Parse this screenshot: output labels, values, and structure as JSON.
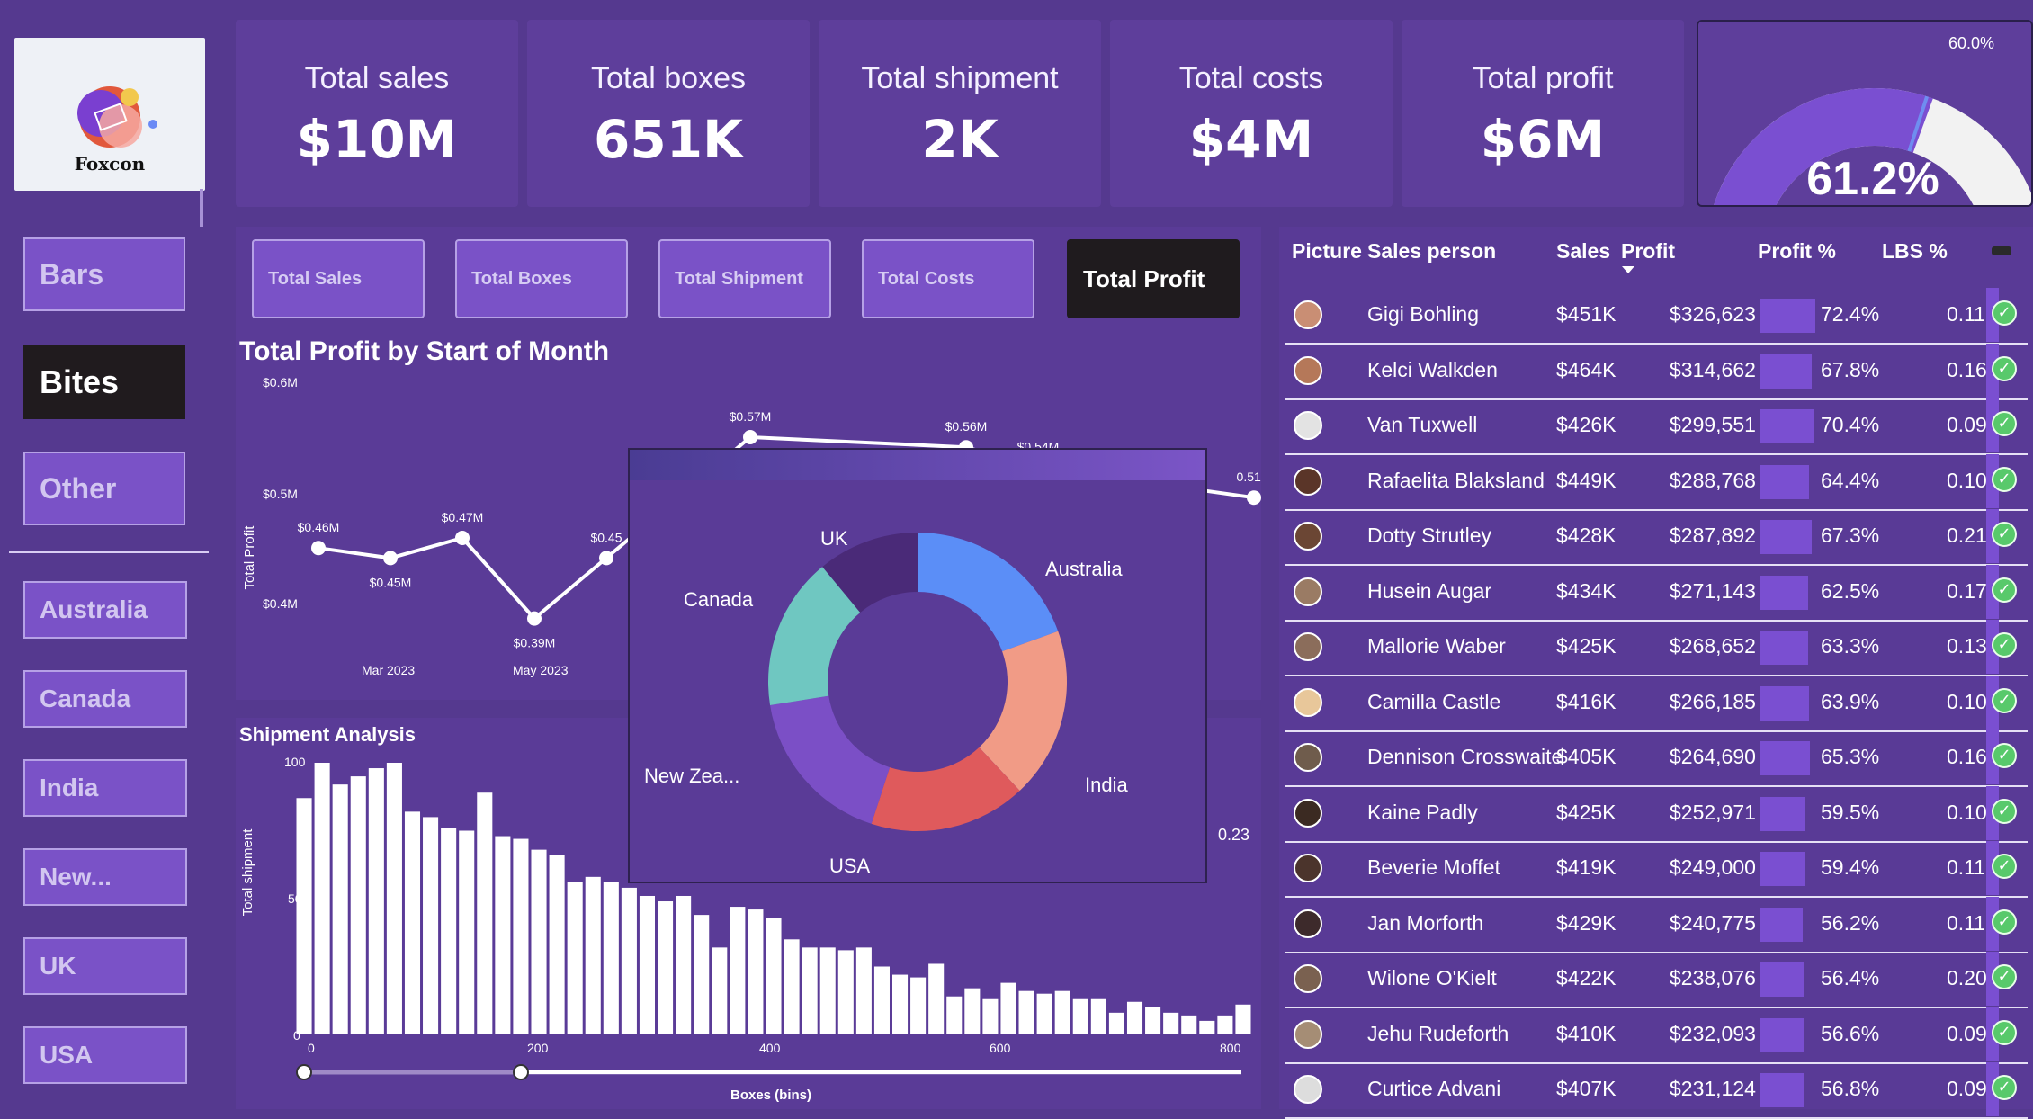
{
  "logo": {
    "brand": "Foxcon"
  },
  "nav": [
    "Bars",
    "Bites",
    "Other"
  ],
  "nav_active": "Bites",
  "countries": [
    "Australia",
    "Canada",
    "India",
    "New...",
    "UK",
    "USA"
  ],
  "kpis": [
    {
      "label": "Total sales",
      "value": "$10M"
    },
    {
      "label": "Total boxes",
      "value": "651K"
    },
    {
      "label": "Total shipment",
      "value": "2K"
    },
    {
      "label": "Total costs",
      "value": "$4M"
    },
    {
      "label": "Total profit",
      "value": "$6M"
    }
  ],
  "gauge": {
    "value": "61.2%",
    "target_label": "60.0%",
    "value_fraction": 0.612,
    "target_fraction": 0.6,
    "fill_color": "#7a4fd1",
    "rest_color": "#f2f2f2"
  },
  "tabs": [
    "Total Sales",
    "Total Boxes",
    "Total Shipment",
    "Total Costs",
    "Total Profit"
  ],
  "active_tab": "Total Profit",
  "line_chart": {
    "title": "Total Profit by Start of Month",
    "ylabel": "Total Profit",
    "y_ticks": [
      "$0.6M",
      "$0.5M",
      "$0.4M"
    ],
    "x_ticks": [
      "Mar 2023",
      "May 2023"
    ],
    "labels": [
      "$0.46M",
      "$0.45M",
      "$0.47M",
      "$0.39M",
      "$0.45",
      "$0.57M",
      "$0.56M",
      "$0.54M",
      "0.51M"
    ]
  },
  "histogram": {
    "title": "Shipment Analysis",
    "ylabel": "Total shipment",
    "xlabel": "Boxes (bins)",
    "y_ticks": [
      "100",
      "50",
      "0"
    ],
    "x_ticks": [
      "0",
      "200",
      "400",
      "600",
      "800"
    ],
    "edge_label": "0.23"
  },
  "chart_data": [
    {
      "type": "line",
      "title": "Total Profit by Start of Month",
      "ylabel": "Total Profit",
      "ylim": [
        0.37,
        0.62
      ],
      "points": [
        {
          "x": 0,
          "y": 0.46
        },
        {
          "x": 1,
          "y": 0.45
        },
        {
          "x": 2,
          "y": 0.47
        },
        {
          "x": 3,
          "y": 0.39
        },
        {
          "x": 4,
          "y": 0.45
        },
        {
          "x": 6,
          "y": 0.57
        },
        {
          "x": 9,
          "y": 0.56
        },
        {
          "x": 10,
          "y": 0.54
        },
        {
          "x": 13,
          "y": 0.51
        }
      ]
    },
    {
      "type": "bar",
      "title": "Shipment Analysis",
      "xlabel": "Boxes (bins)",
      "ylabel": "Total shipment",
      "xlim": [
        0,
        800
      ],
      "ylim": [
        0,
        100
      ],
      "values": [
        87,
        100,
        92,
        95,
        98,
        100,
        82,
        80,
        76,
        75,
        89,
        73,
        72,
        68,
        66,
        56,
        58,
        56,
        54,
        51,
        49,
        51,
        44,
        32,
        47,
        46,
        43,
        35,
        32,
        32,
        31,
        32,
        25,
        22,
        21,
        26,
        14,
        17,
        13,
        19,
        16,
        15,
        16,
        13,
        13,
        8,
        12,
        10,
        8,
        7,
        5,
        7,
        11
      ]
    },
    {
      "type": "pie",
      "slices": [
        {
          "label": "Australia",
          "value": 19.5,
          "color": "#5b8ef7"
        },
        {
          "label": "India",
          "value": 18.5,
          "color": "#f19b86"
        },
        {
          "label": "USA",
          "value": 17.0,
          "color": "#df5a5c"
        },
        {
          "label": "New Zea...",
          "value": 17.5,
          "color": "#7b4fc6"
        },
        {
          "label": "Canada",
          "value": 16.5,
          "color": "#6fc7c1"
        },
        {
          "label": "UK",
          "value": 11.0,
          "color": "#4a2a78"
        }
      ]
    }
  ],
  "table": {
    "headers": [
      "Picture",
      "Sales person",
      "Sales",
      "Profit",
      "Profit %",
      "LBS %"
    ],
    "rows": [
      [
        "Gigi Bohling",
        "$451K",
        "$326,623",
        "72.4%",
        "0.11"
      ],
      [
        "Kelci Walkden",
        "$464K",
        "$314,662",
        "67.8%",
        "0.16"
      ],
      [
        "Van Tuxwell",
        "$426K",
        "$299,551",
        "70.4%",
        "0.09"
      ],
      [
        "Rafaelita Blaksland",
        "$449K",
        "$288,768",
        "64.4%",
        "0.10"
      ],
      [
        "Dotty Strutley",
        "$428K",
        "$287,892",
        "67.3%",
        "0.21"
      ],
      [
        "Husein Augar",
        "$434K",
        "$271,143",
        "62.5%",
        "0.17"
      ],
      [
        "Mallorie Waber",
        "$425K",
        "$268,652",
        "63.3%",
        "0.13"
      ],
      [
        "Camilla Castle",
        "$416K",
        "$266,185",
        "63.9%",
        "0.10"
      ],
      [
        "Dennison Crosswaite",
        "$405K",
        "$264,690",
        "65.3%",
        "0.16"
      ],
      [
        "Kaine Padly",
        "$425K",
        "$252,971",
        "59.5%",
        "0.10"
      ],
      [
        "Beverie Moffet",
        "$419K",
        "$249,000",
        "59.4%",
        "0.11"
      ],
      [
        "Jan Morforth",
        "$429K",
        "$240,775",
        "56.2%",
        "0.11"
      ],
      [
        "Wilone O'Kielt",
        "$422K",
        "$238,076",
        "56.4%",
        "0.20"
      ],
      [
        "Jehu Rudeforth",
        "$410K",
        "$232,093",
        "56.6%",
        "0.09"
      ],
      [
        "Curtice Advani",
        "$407K",
        "$231,124",
        "56.8%",
        "0.09"
      ]
    ]
  }
}
